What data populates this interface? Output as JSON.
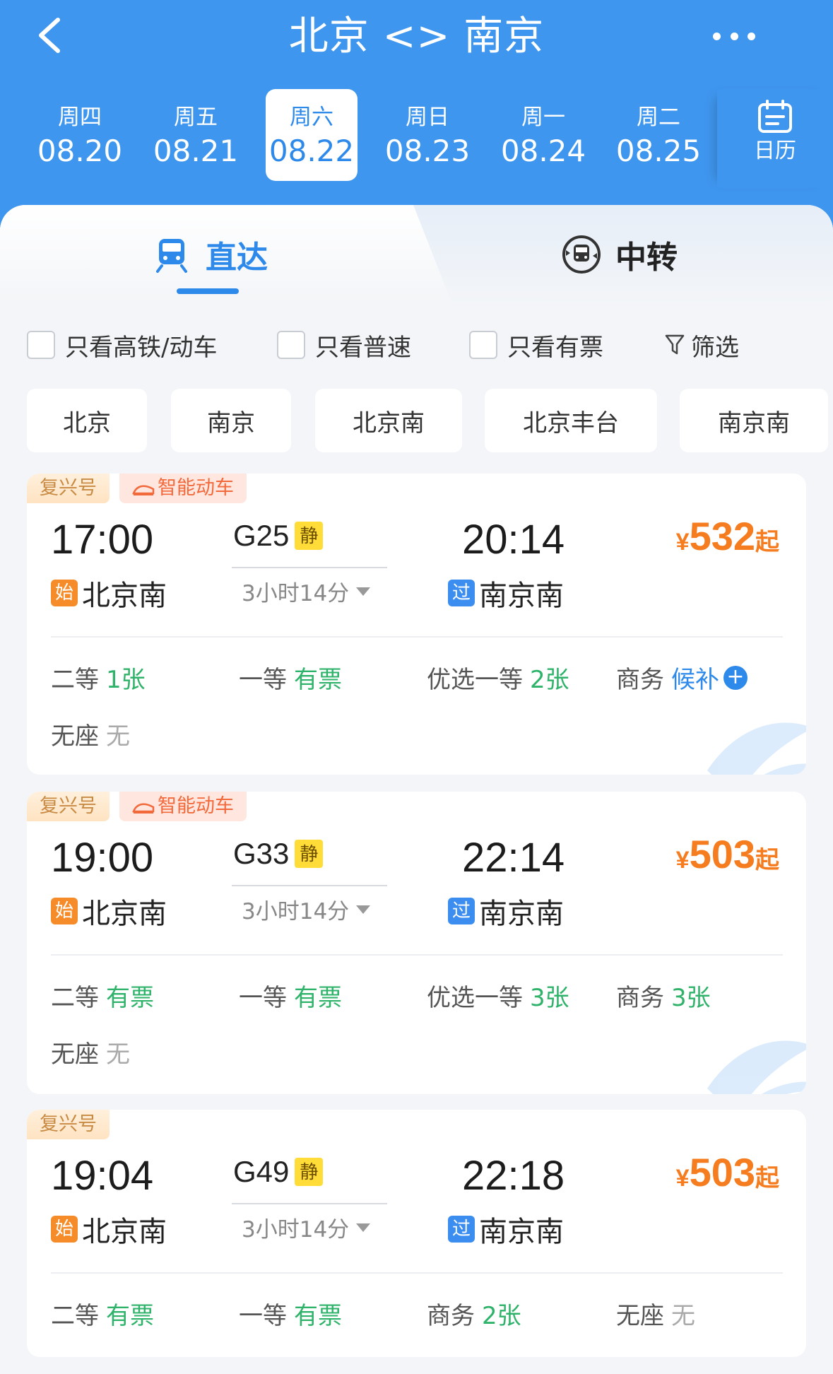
{
  "header": {
    "title": "北京 <> 南京"
  },
  "dates": [
    {
      "weekday": "周四",
      "date": "08.20"
    },
    {
      "weekday": "周五",
      "date": "08.21"
    },
    {
      "weekday": "周六",
      "date": "08.22"
    },
    {
      "weekday": "周日",
      "date": "08.23"
    },
    {
      "weekday": "周一",
      "date": "08.24"
    },
    {
      "weekday": "周二",
      "date": "08.25"
    }
  ],
  "calendar_label": "日历",
  "tabs": {
    "direct": "直达",
    "transfer": "中转"
  },
  "filters": {
    "high_speed": "只看高铁/动车",
    "normal": "只看普速",
    "available": "只看有票",
    "screen": "筛选"
  },
  "stations": [
    "北京",
    "南京",
    "北京南",
    "北京丰台",
    "南京南"
  ],
  "trains": [
    {
      "badges": [
        "复兴号",
        "智能动车"
      ],
      "dep_time": "17:00",
      "arr_time": "20:14",
      "dep_station": "北京南",
      "arr_station": "南京南",
      "dep_tag": "始",
      "arr_tag": "过",
      "train_no": "G25",
      "quiet": "静",
      "duration": "3小时14分",
      "currency": "¥",
      "price": "532",
      "price_suffix": "起",
      "seats": [
        {
          "name": "二等",
          "count": "1张"
        },
        {
          "name": "一等",
          "count": "有票"
        },
        {
          "name": "优选一等",
          "count": "2张"
        },
        {
          "name": "商务",
          "count": "候补"
        },
        {
          "name": "无座",
          "count": "无"
        }
      ]
    },
    {
      "badges": [
        "复兴号",
        "智能动车"
      ],
      "dep_time": "19:00",
      "arr_time": "22:14",
      "dep_station": "北京南",
      "arr_station": "南京南",
      "dep_tag": "始",
      "arr_tag": "过",
      "train_no": "G33",
      "quiet": "静",
      "duration": "3小时14分",
      "currency": "¥",
      "price": "503",
      "price_suffix": "起",
      "seats": [
        {
          "name": "二等",
          "count": "有票"
        },
        {
          "name": "一等",
          "count": "有票"
        },
        {
          "name": "优选一等",
          "count": "3张"
        },
        {
          "name": "商务",
          "count": "3张"
        },
        {
          "name": "无座",
          "count": "无"
        }
      ]
    },
    {
      "badges": [
        "复兴号"
      ],
      "dep_time": "19:04",
      "arr_time": "22:18",
      "dep_station": "北京南",
      "arr_station": "南京南",
      "dep_tag": "始",
      "arr_tag": "过",
      "train_no": "G49",
      "quiet": "静",
      "duration": "3小时14分",
      "currency": "¥",
      "price": "503",
      "price_suffix": "起",
      "seats": [
        {
          "name": "二等",
          "count": "有票"
        },
        {
          "name": "一等",
          "count": "有票"
        },
        {
          "name": "商务",
          "count": "2张"
        },
        {
          "name": "无座",
          "count": "无"
        }
      ]
    }
  ],
  "colors": {
    "brand_blue": "#3f96ee",
    "price_orange": "#f57c1f",
    "available_green": "#2fb36a"
  }
}
